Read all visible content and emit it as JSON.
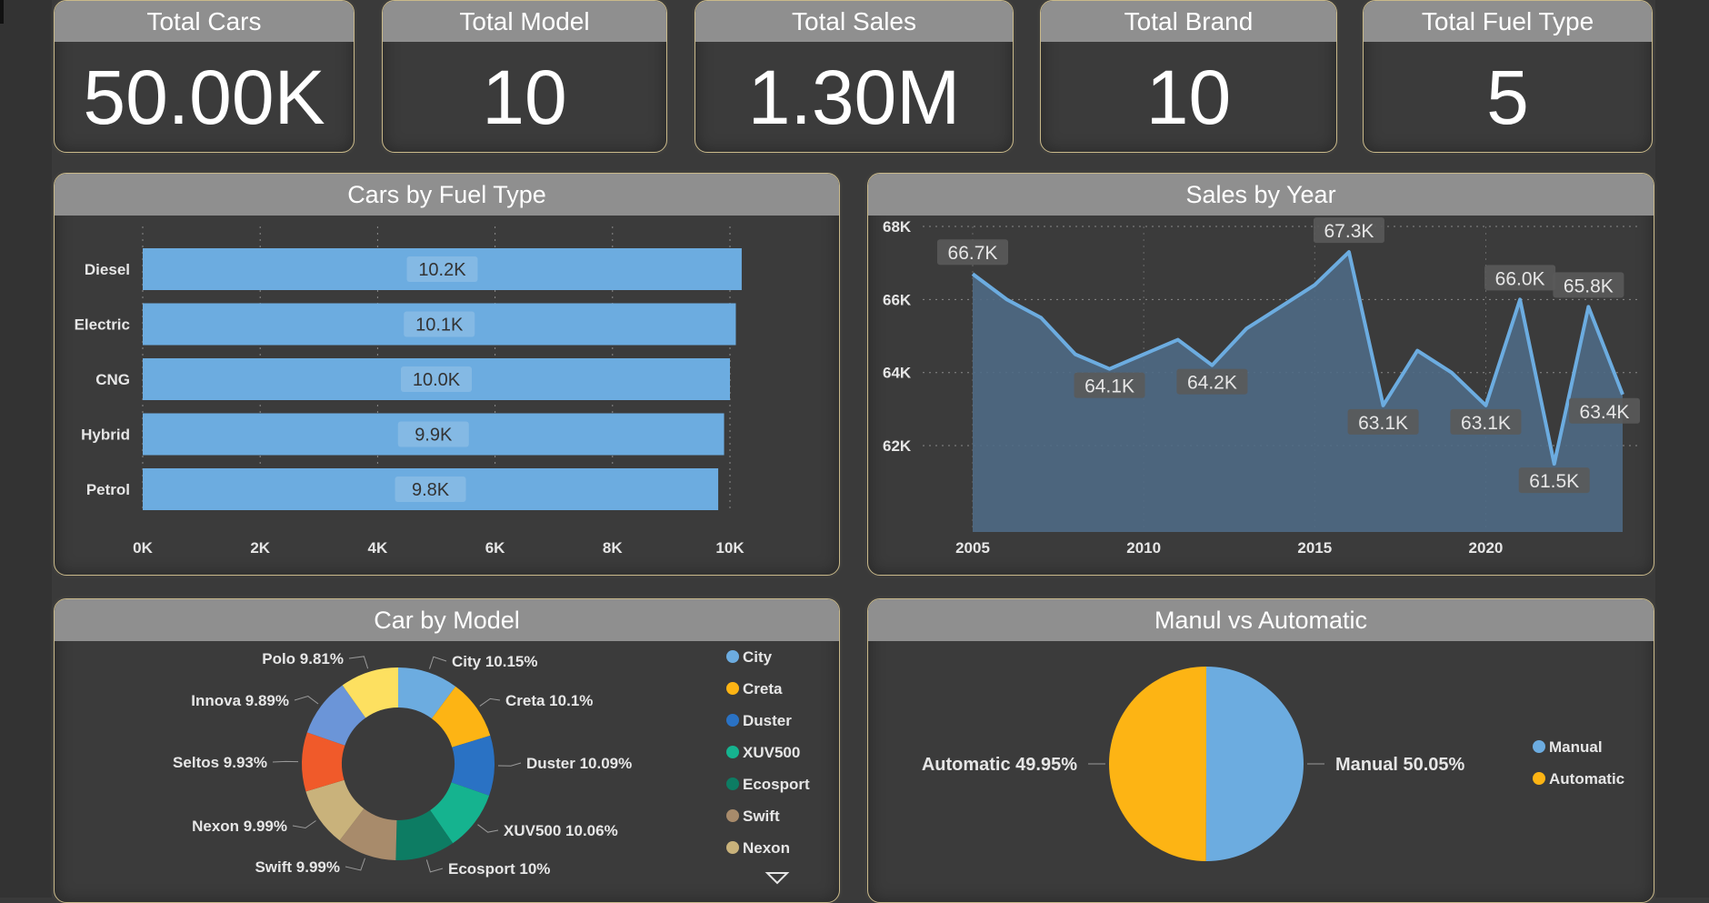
{
  "kpis": [
    {
      "title": "Total Cars",
      "value": "50.00K"
    },
    {
      "title": "Total Model",
      "value": "10"
    },
    {
      "title": "Total Sales",
      "value": "1.30M"
    },
    {
      "title": "Total Brand",
      "value": "10"
    },
    {
      "title": "Total Fuel Type",
      "value": "5"
    }
  ],
  "panels": {
    "fuel": {
      "title": "Cars by Fuel Type"
    },
    "year": {
      "title": "Sales by Year"
    },
    "model": {
      "title": "Car by Model"
    },
    "trans": {
      "title": "Manul vs Automatic"
    }
  },
  "colors": {
    "bar": "#6cace0",
    "area_fill": "#4f6a85",
    "line": "#6cace0",
    "manual": "#6cace0",
    "automatic": "#fdb414"
  },
  "chart_data": [
    {
      "type": "bar",
      "orientation": "horizontal",
      "title": "Cars by Fuel Type",
      "categories": [
        "Diesel",
        "Electric",
        "CNG",
        "Hybrid",
        "Petrol"
      ],
      "values": [
        10.2,
        10.1,
        10.0,
        9.9,
        9.8
      ],
      "data_labels": [
        "10.2K",
        "10.1K",
        "10.0K",
        "9.9K",
        "9.8K"
      ],
      "xlim": [
        0,
        10
      ],
      "xticks": [
        "0K",
        "2K",
        "4K",
        "6K",
        "8K",
        "10K"
      ],
      "grid": "vertical dotted"
    },
    {
      "type": "area",
      "title": "Sales by Year",
      "x": [
        2005,
        2006,
        2007,
        2008,
        2009,
        2010,
        2011,
        2012,
        2013,
        2014,
        2015,
        2016,
        2017,
        2018,
        2019,
        2020,
        2021,
        2022,
        2023,
        2024
      ],
      "values": [
        66.7,
        66.0,
        65.5,
        64.5,
        64.1,
        64.5,
        64.9,
        64.2,
        65.2,
        65.8,
        66.4,
        67.3,
        63.1,
        64.6,
        64.0,
        63.1,
        66.0,
        61.5,
        65.8,
        63.4
      ],
      "data_labels": [
        {
          "year": 2005,
          "label": "66.7K"
        },
        {
          "year": 2009,
          "label": "64.1K"
        },
        {
          "year": 2012,
          "label": "64.2K"
        },
        {
          "year": 2016,
          "label": "67.3K"
        },
        {
          "year": 2017,
          "label": "63.1K"
        },
        {
          "year": 2020,
          "label": "63.1K"
        },
        {
          "year": 2021,
          "label": "66.0K"
        },
        {
          "year": 2022,
          "label": "61.5K"
        },
        {
          "year": 2023,
          "label": "65.8K"
        },
        {
          "year": 2024,
          "label": "63.4K"
        }
      ],
      "ylim": [
        61,
        68
      ],
      "yticks": [
        "62K",
        "64K",
        "66K",
        "68K"
      ],
      "xticks": [
        "2005",
        "2010",
        "2015",
        "2020"
      ],
      "grid": "horizontal dotted"
    },
    {
      "type": "pie",
      "variant": "donut",
      "title": "Car by Model",
      "slices": [
        {
          "name": "City",
          "value": 10.15,
          "label": "City 10.15%",
          "color": "#6cace0"
        },
        {
          "name": "Creta",
          "value": 10.1,
          "label": "Creta 10.1%",
          "color": "#fdb414"
        },
        {
          "name": "Duster",
          "value": 10.09,
          "label": "Duster 10.09%",
          "color": "#2a72c4"
        },
        {
          "name": "XUV500",
          "value": 10.06,
          "label": "XUV500 10.06%",
          "color": "#15b38f"
        },
        {
          "name": "Ecosport",
          "value": 10.0,
          "label": "Ecosport 10%",
          "color": "#0d7c63"
        },
        {
          "name": "Swift",
          "value": 9.99,
          "label": "Swift 9.99%",
          "color": "#a88b6b"
        },
        {
          "name": "Nexon",
          "value": 9.99,
          "label": "Nexon 9.99%",
          "color": "#c9b27b"
        },
        {
          "name": "Seltos",
          "value": 9.93,
          "label": "Seltos 9.93%",
          "color": "#f05a2a"
        },
        {
          "name": "Innova",
          "value": 9.89,
          "label": "Innova 9.89%",
          "color": "#6b95d8"
        },
        {
          "name": "Polo",
          "value": 9.81,
          "label": "Polo 9.81%",
          "color": "#fde060"
        }
      ],
      "legend": [
        "City",
        "Creta",
        "Duster",
        "XUV500",
        "Ecosport",
        "Swift",
        "Nexon"
      ],
      "legend_position": "right"
    },
    {
      "type": "pie",
      "title": "Manul vs Automatic",
      "slices": [
        {
          "name": "Manual",
          "value": 50.05,
          "label": "Manual 50.05%",
          "color": "#6cace0"
        },
        {
          "name": "Automatic",
          "value": 49.95,
          "label": "Automatic 49.95%",
          "color": "#fdb414"
        }
      ],
      "legend": [
        "Manual",
        "Automatic"
      ],
      "legend_position": "right"
    }
  ]
}
